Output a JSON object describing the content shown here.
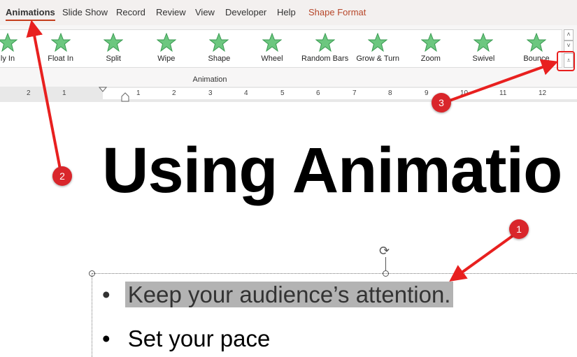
{
  "tabs": [
    {
      "label": "Animations",
      "active": true
    },
    {
      "label": "Slide Show"
    },
    {
      "label": "Record"
    },
    {
      "label": "Review"
    },
    {
      "label": "View"
    },
    {
      "label": "Developer"
    },
    {
      "label": "Help"
    },
    {
      "label": "Shape Format",
      "color": "#b7472a"
    }
  ],
  "gallery": [
    "ly In",
    "Float In",
    "Split",
    "Wipe",
    "Shape",
    "Wheel",
    "Random Bars",
    "Grow & Turn",
    "Zoom",
    "Swivel",
    "Bounce"
  ],
  "group_label": "Animation",
  "ruler": [
    "2",
    "1",
    "1",
    "2",
    "3",
    "4",
    "5",
    "6",
    "7",
    "8",
    "9",
    "10",
    "11",
    "12"
  ],
  "slide": {
    "title": "Using Animatio",
    "bullets": [
      "Keep your audience’s attention.",
      "Set your pace"
    ]
  },
  "annotations": [
    "1",
    "2",
    "3"
  ],
  "colors": {
    "accent": "#c43e1c",
    "annotation": "#e8201f",
    "star": "#6cc77f"
  }
}
